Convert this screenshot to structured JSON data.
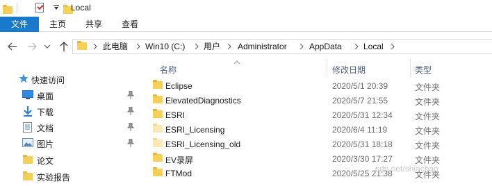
{
  "window": {
    "title": "Local"
  },
  "ribbon": {
    "tabs": [
      "文件",
      "主页",
      "共享",
      "查看"
    ]
  },
  "address": {
    "crumbs": [
      "此电脑",
      "Win10 (C:)",
      "用户",
      "Administrator",
      "AppData",
      "Local"
    ]
  },
  "nav_pane": {
    "items": [
      {
        "label": "快速访问",
        "icon": "star-icon",
        "pinned": false
      },
      {
        "label": "桌面",
        "icon": "desktop-icon",
        "pinned": true
      },
      {
        "label": "下载",
        "icon": "download-icon",
        "pinned": true
      },
      {
        "label": "文档",
        "icon": "document-icon",
        "pinned": true
      },
      {
        "label": "图片",
        "icon": "picture-icon",
        "pinned": true
      },
      {
        "label": "论文",
        "icon": "folder-icon",
        "pinned": false
      },
      {
        "label": "实验报告",
        "icon": "folder-icon",
        "pinned": false
      }
    ]
  },
  "file_list": {
    "columns": {
      "name": "名称",
      "date": "修改日期",
      "type": "类型"
    },
    "rows": [
      {
        "name": "Eclipse",
        "date": "2020/5/1 20:39",
        "type": "文件夹",
        "faded": false
      },
      {
        "name": "ElevatedDiagnostics",
        "date": "2020/5/7 21:55",
        "type": "文件夹",
        "faded": false
      },
      {
        "name": "ESRI",
        "date": "2020/5/31 12:34",
        "type": "文件夹",
        "faded": false
      },
      {
        "name": "ESRI_Licensing",
        "date": "2020/6/4 11:19",
        "type": "文件夹",
        "faded": true
      },
      {
        "name": "ESRI_Licensing_old",
        "date": "2020/5/31 18:18",
        "type": "文件夹",
        "faded": true
      },
      {
        "name": "EV录屏",
        "date": "2020/3/30 17:27",
        "type": "文件夹",
        "faded": false
      },
      {
        "name": "FTMod",
        "date": "2020/5/25 21:38",
        "type": "文件夹",
        "faded": false
      }
    ]
  },
  "watermark": "sdn.net/shiachan",
  "colors": {
    "accent": "#1979ca",
    "folder": "#f6cf57",
    "header_text": "#4c607a"
  }
}
